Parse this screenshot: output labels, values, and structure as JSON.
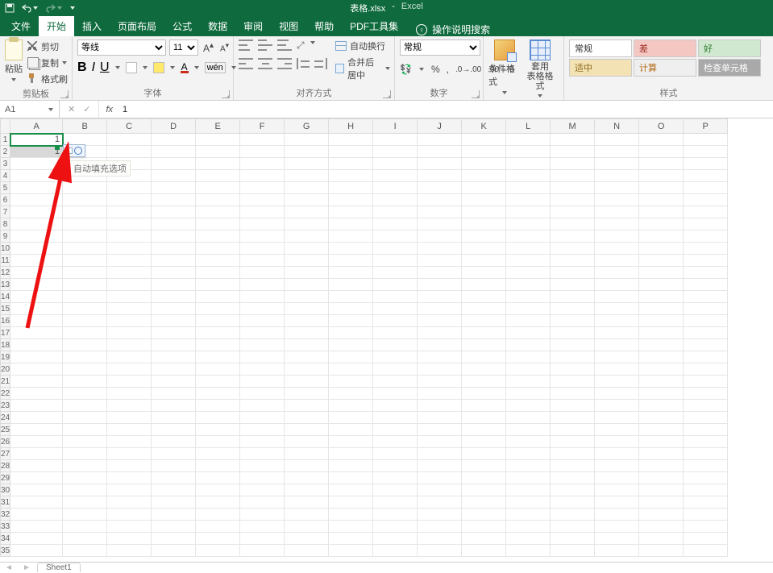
{
  "app": {
    "filename": "表格.xlsx",
    "name": "Excel"
  },
  "qat": {
    "save": "保存",
    "undo": "撤销",
    "redo": "重做"
  },
  "tabs": {
    "file": "文件",
    "home": "开始",
    "insert": "插入",
    "pageLayout": "页面布局",
    "formulas": "公式",
    "data": "数据",
    "review": "审阅",
    "view": "视图",
    "help": "帮助",
    "pdf_tools": "PDF工具集",
    "tell_me": "操作说明搜索"
  },
  "ribbon": {
    "clipboard": {
      "label": "剪贴板",
      "paste": "粘贴",
      "cut": "剪切",
      "copy": "复制",
      "format_painter": "格式刷"
    },
    "font": {
      "label": "字体",
      "name": "等线",
      "size": "11",
      "bold": "B",
      "italic": "I",
      "underline": "U",
      "textA": "A"
    },
    "alignment": {
      "label": "对齐方式",
      "wrap": "自动换行",
      "merge": "合并后居中"
    },
    "number": {
      "label": "数字",
      "format": "常规",
      "percent": "%",
      "comma": ","
    },
    "formats": {
      "conditional": "条件格式",
      "table": "套用\n表格格式"
    },
    "cell_styles": {
      "label": "样式",
      "normal": "常规",
      "bad": "差",
      "good": "好",
      "moderate": "适中",
      "calc": "计算",
      "check": "检查单元格"
    }
  },
  "fxbar": {
    "namebox": "A1",
    "cancel": "✕",
    "confirm": "✓",
    "fx": "fx",
    "value": "1"
  },
  "columns": [
    "A",
    "B",
    "C",
    "D",
    "E",
    "F",
    "G",
    "H",
    "I",
    "J",
    "K",
    "L",
    "M",
    "N",
    "O",
    "P"
  ],
  "cells": {
    "A1": "1",
    "A2": "1"
  },
  "autofill": {
    "tooltip": "自动填充选项"
  },
  "sheet": {
    "name": "Sheet1"
  }
}
